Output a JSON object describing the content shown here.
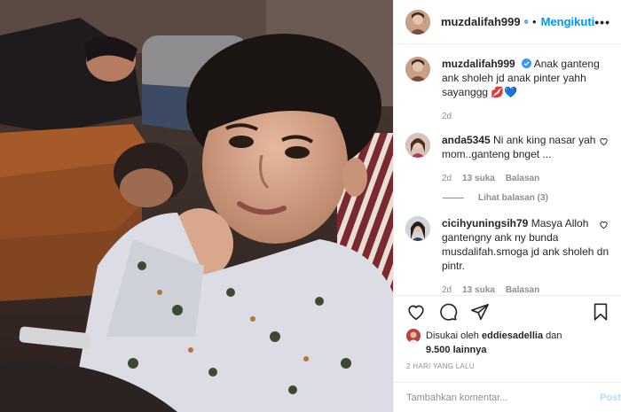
{
  "header": {
    "username": "muzdalifah999",
    "dot": "•",
    "follow_label": "Mengikuti",
    "more_label": "•••"
  },
  "caption": {
    "username": "muzdalifah999",
    "text": "Anak ganteng ank sholeh jd anak pinter yahh sayanggg",
    "emoji": "💋💙",
    "age": "2d"
  },
  "comments": [
    {
      "username": "anda5345",
      "text": "Ni ank king nasar yah mom..ganteng bnget ...",
      "age": "2d",
      "likes": "13 suka",
      "reply_label": "Balasan",
      "view_replies": "Lihat balasan (3)"
    },
    {
      "username": "cicihyuningsih79",
      "text": "Masya Alloh gantengny ank ny bunda musdalifah.smoga jd ank sholeh dn pintr.",
      "age": "2d",
      "likes": "13 suka",
      "reply_label": "Balasan"
    }
  ],
  "likes": {
    "prefix": "Disukai oleh",
    "user": "eddiesadellia",
    "and": "dan",
    "count": "9.500 lainnya"
  },
  "timestamp": "2 HARI YANG LALU",
  "comment_box": {
    "placeholder": "Tambahkan komentar...",
    "post_label": "Posting"
  },
  "colors": {
    "accent": "#0095f6",
    "heart_red": "#ed4956",
    "text": "#262626",
    "muted": "#8e8e8e"
  }
}
